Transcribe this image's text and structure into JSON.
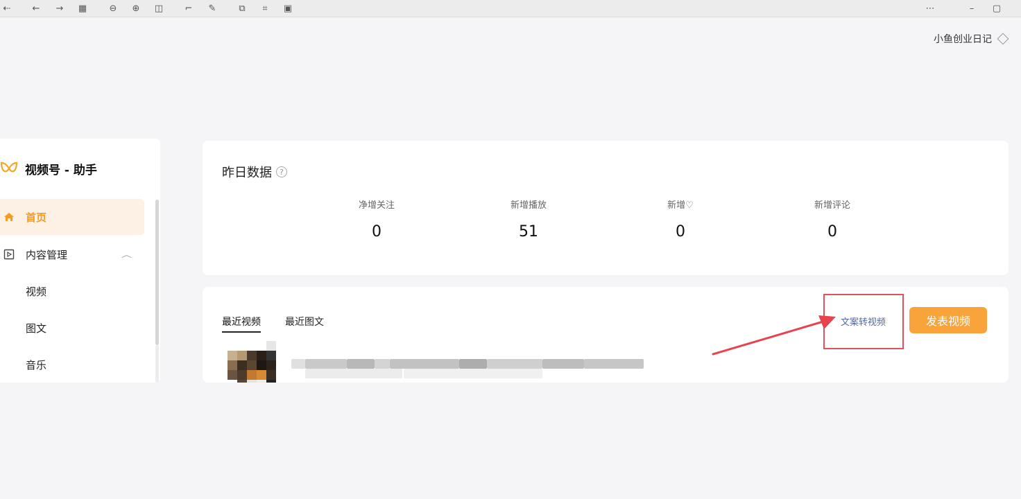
{
  "toolbar": {
    "icons": [
      "back-icon",
      "arrow-left-icon",
      "arrow-right-icon",
      "grid-icon",
      "zoom-out-icon",
      "zoom-in-icon",
      "chart-icon",
      "crop-icon",
      "edit-icon",
      "share-icon",
      "scan-icon",
      "save-icon",
      "more-icon",
      "minimize-icon",
      "maximize-icon",
      "close-icon"
    ]
  },
  "account": {
    "name": "小鱼创业日记"
  },
  "sidebar": {
    "brand": "视频号 - 助手",
    "items": [
      {
        "label": "首页",
        "icon": "home-icon",
        "active": true
      },
      {
        "label": "内容管理",
        "icon": "play-square-icon",
        "expanded": true
      },
      {
        "label": "视频"
      },
      {
        "label": "图文"
      },
      {
        "label": "音乐"
      }
    ]
  },
  "stats": {
    "title": "昨日数据",
    "items": [
      {
        "label": "净增关注",
        "value": "0"
      },
      {
        "label": "新增播放",
        "value": "51"
      },
      {
        "label": "新增♡",
        "value": "0"
      },
      {
        "label": "新增评论",
        "value": "0"
      }
    ]
  },
  "recent": {
    "tabs": [
      "最近视频",
      "最近图文"
    ],
    "convert_link": "文案转视频",
    "publish_button": "发表视频"
  },
  "colors": {
    "accent": "#f8a43a",
    "active_bg": "#fdf1e6",
    "highlight": "#e0525a",
    "link": "#5566aa"
  }
}
